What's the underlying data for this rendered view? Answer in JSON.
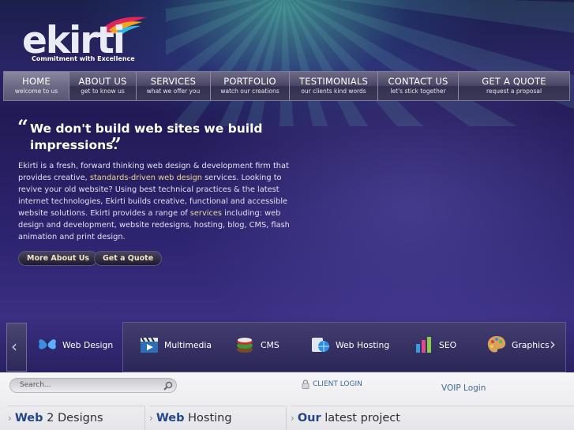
{
  "brand": {
    "name": "ekirti",
    "tagline": "Commitment with Excellence",
    "colors": {
      "nav": "#4a4666",
      "accent_link": "#e9d98a",
      "link_blue": "#3a6a9c",
      "section_blue": "#24458a"
    }
  },
  "nav": [
    {
      "label": "HOME",
      "sub": "welcome to us",
      "active": true
    },
    {
      "label": "ABOUT US",
      "sub": "get to know us"
    },
    {
      "label": "SERVICES",
      "sub": "what we offer you"
    },
    {
      "label": "PORTFOLIO",
      "sub": "watch our creations"
    },
    {
      "label": "TESTIMONIALS",
      "sub": "our clients kind words"
    },
    {
      "label": "CONTACT US",
      "sub": "let's stick together"
    },
    {
      "label": "GET A QUOTE",
      "sub": "request a proposal"
    }
  ],
  "intro": {
    "open_quote": "“",
    "close_quote": "”",
    "headline_1": "We don't build web sites we build",
    "headline_2": "impressions.",
    "p1": "Ekirti is a fresh, forward thinking web design & development firm that provides creative, ",
    "link1": "standards-driven web design",
    "p2": " services. Looking to revive your old website? Using best technical practices & the latest internet technologies, Ekirti builds creative, functional and accessible website solutions. Ekirti provides a range of ",
    "link2": "services",
    "p3": " including: web design and development, website redesigns, hosting, blog, CMS, flash animation and print design.",
    "btn_about": "More About Us",
    "btn_quote": "Get a Quote"
  },
  "carousel": {
    "prev": "‹",
    "next": "›",
    "items": [
      {
        "label": "Web Design",
        "icon": "butterfly-icon"
      },
      {
        "label": "Multimedia",
        "icon": "film-clapper-icon"
      },
      {
        "label": "CMS",
        "icon": "database-stack-icon"
      },
      {
        "label": "Web Hosting",
        "icon": "globe-server-icon"
      },
      {
        "label": "SEO",
        "icon": "bar-chart-icon"
      },
      {
        "label": "Graphics",
        "icon": "palette-icon"
      }
    ]
  },
  "footer": {
    "search_placeholder": "Search...",
    "client_login": "CLIENT LOGIN",
    "voip_login": "VOIP Login",
    "sections": [
      {
        "strong": "Web",
        "rest": " 2 Designs"
      },
      {
        "strong": "Web",
        "rest": " Hosting"
      },
      {
        "strong": "Our",
        "rest": " latest project"
      }
    ]
  }
}
